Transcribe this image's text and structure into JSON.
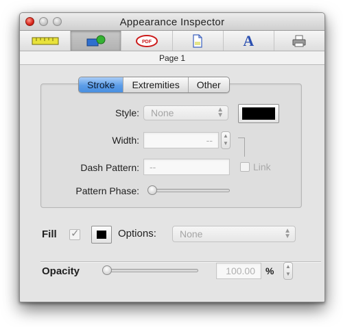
{
  "window": {
    "title": "Appearance Inspector"
  },
  "toolbar": {
    "items": [
      {
        "icon": "ruler-icon"
      },
      {
        "icon": "shape-icon"
      },
      {
        "icon": "pdf-icon",
        "text": "PDF"
      },
      {
        "icon": "document-icon"
      },
      {
        "icon": "text-icon",
        "text": "A"
      },
      {
        "icon": "printer-icon"
      }
    ]
  },
  "page_label": "Page 1",
  "stroke": {
    "tabs": [
      "Stroke",
      "Extremities",
      "Other"
    ],
    "style_label": "Style:",
    "style_value": "None",
    "width_label": "Width:",
    "width_value": "--",
    "dash_label": "Dash Pattern:",
    "dash_value": "--",
    "link_label": "Link",
    "phase_label": "Pattern Phase:",
    "stroke_color": "#000000"
  },
  "fill": {
    "label": "Fill",
    "checked_mark": "✓",
    "options_label": "Options:",
    "options_value": "None",
    "fill_color": "#000000"
  },
  "opacity": {
    "label": "Opacity",
    "value": "100.00",
    "unit": "%"
  }
}
